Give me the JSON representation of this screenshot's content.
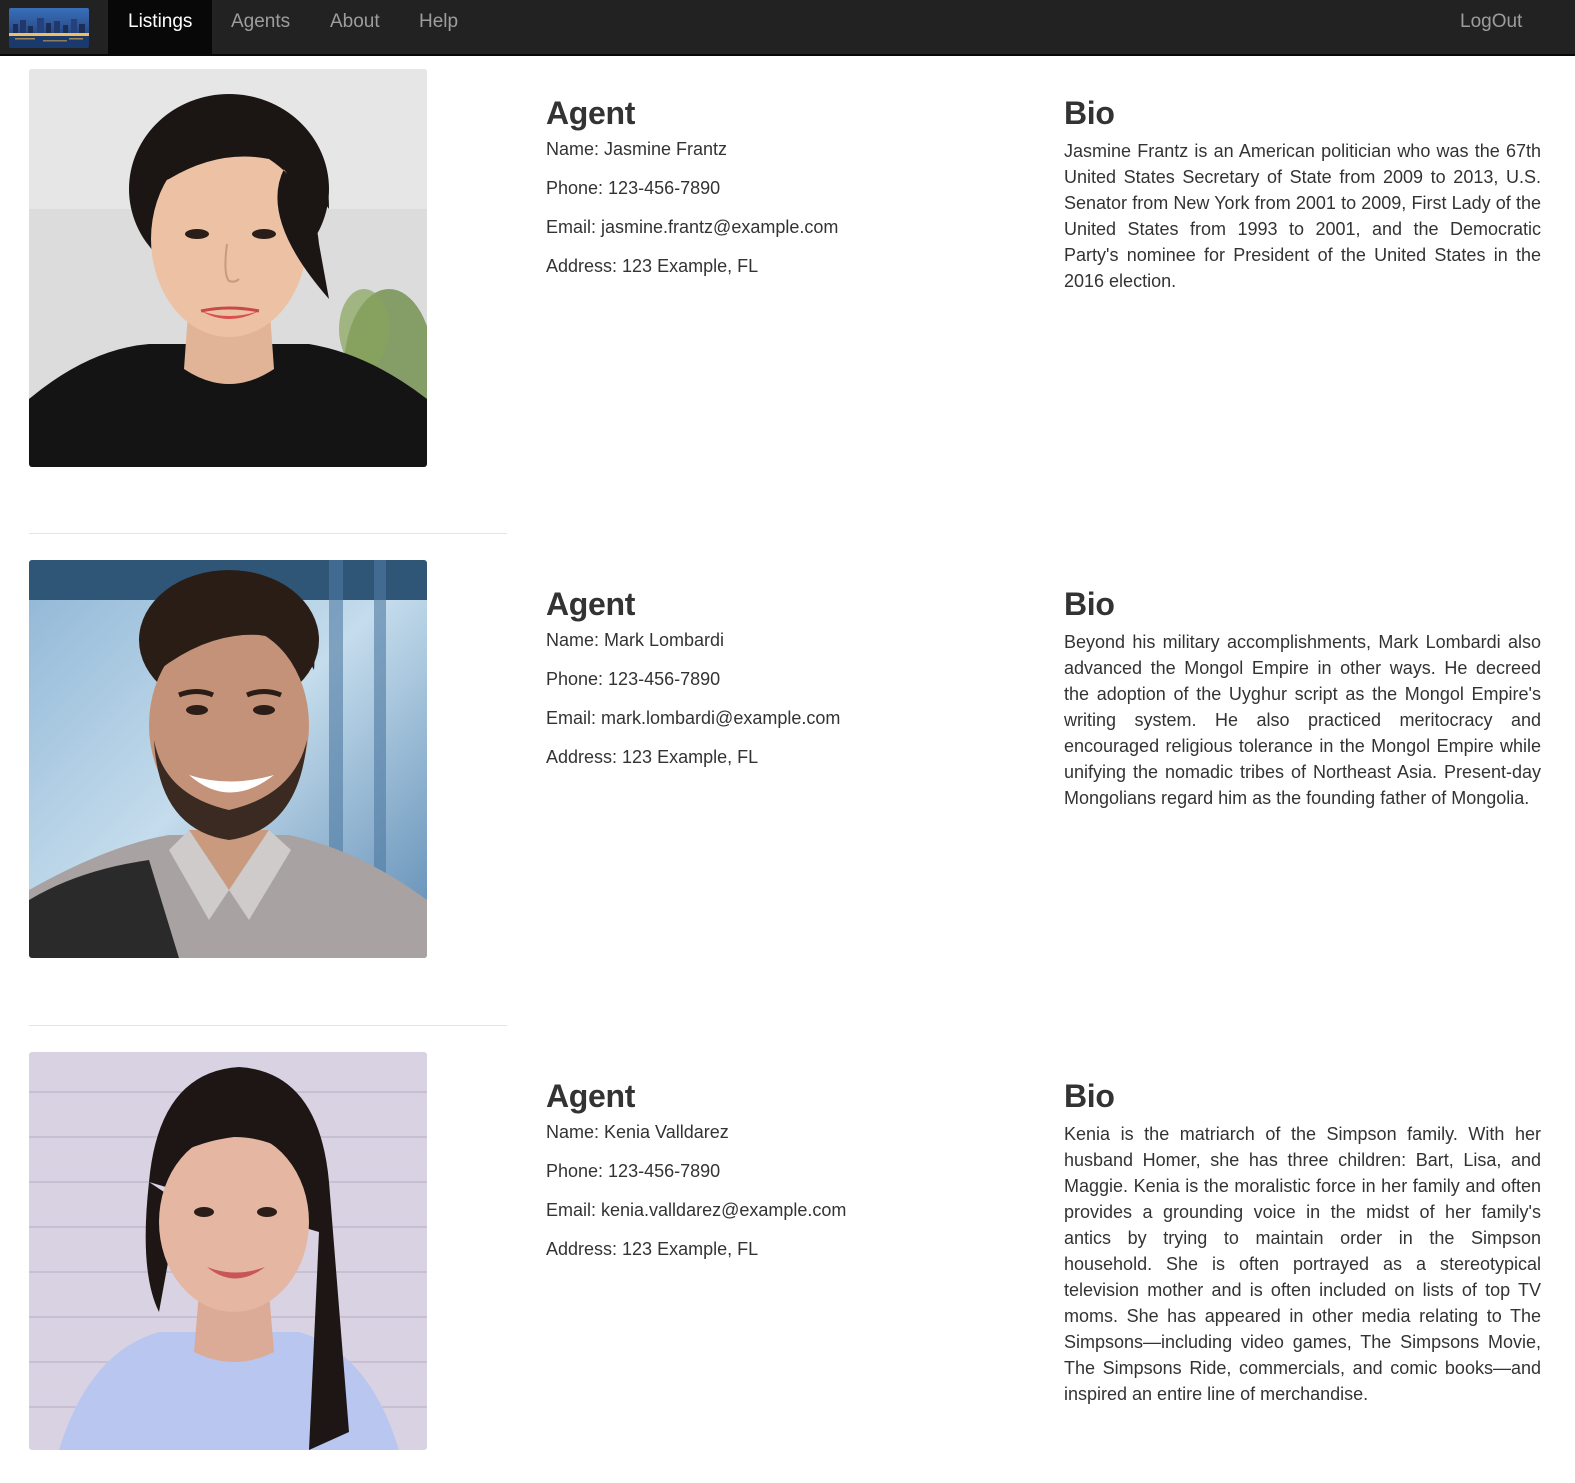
{
  "navbar": {
    "brand_icon": "city-skyline-logo",
    "items": [
      {
        "label": "Listings",
        "active": true
      },
      {
        "label": "Agents",
        "active": false
      },
      {
        "label": "About",
        "active": false
      },
      {
        "label": "Help",
        "active": false
      }
    ],
    "logout_label": "LogOut"
  },
  "agents": [
    {
      "heading": "Agent",
      "name": "Name: Jasmine Frantz",
      "phone": "Phone: 123-456-7890",
      "email": "Email: jasmine.frantz@example.com",
      "address": "Address: 123 Example, FL",
      "bio_heading": "Bio",
      "bio": "Jasmine Frantz is an American politician who was the 67th United States Secretary of State from 2009 to 2013, U.S. Senator from New York from 2001 to 2009, First Lady of the United States from 1993 to 2001, and the Democratic Party's nominee for President of the United States in the 2016 election."
    },
    {
      "heading": "Agent",
      "name": "Name: Mark Lombardi",
      "phone": "Phone: 123-456-7890",
      "email": "Email: mark.lombardi@example.com",
      "address": "Address: 123 Example, FL",
      "bio_heading": "Bio",
      "bio": "Beyond his military accomplishments, Mark Lombardi also advanced the Mongol Empire in other ways. He decreed the adoption of the Uyghur script as the Mongol Empire's writing system. He also practiced meritocracy and encouraged religious tolerance in the Mongol Empire while unifying the nomadic tribes of Northeast Asia. Present-day Mongolians regard him as the founding father of Mongolia."
    },
    {
      "heading": "Agent",
      "name": "Name: Kenia Valldarez",
      "phone": "Phone: 123-456-7890",
      "email": "Email: kenia.valldarez@example.com",
      "address": "Address: 123 Example, FL",
      "bio_heading": "Bio",
      "bio": "Kenia is the matriarch of the Simpson family. With her husband Homer, she has three children: Bart, Lisa, and Maggie. Kenia is the moralistic force in her family and often provides a grounding voice in the midst of her family's antics by trying to maintain order in the Simpson household. She is often portrayed as a stereotypical television mother and is often included on lists of top TV moms. She has appeared in other media relating to The Simpsons—including video games, The Simpsons Movie, The Simpsons Ride, commercials, and comic books—and inspired an entire line of merchandise."
    }
  ],
  "colors": {
    "navbar_bg": "#222222",
    "navbar_active_bg": "#080808",
    "nav_text": "#9d9d9d",
    "nav_text_active": "#ffffff",
    "body_text": "#333333",
    "divider": "#e5e5e5"
  }
}
